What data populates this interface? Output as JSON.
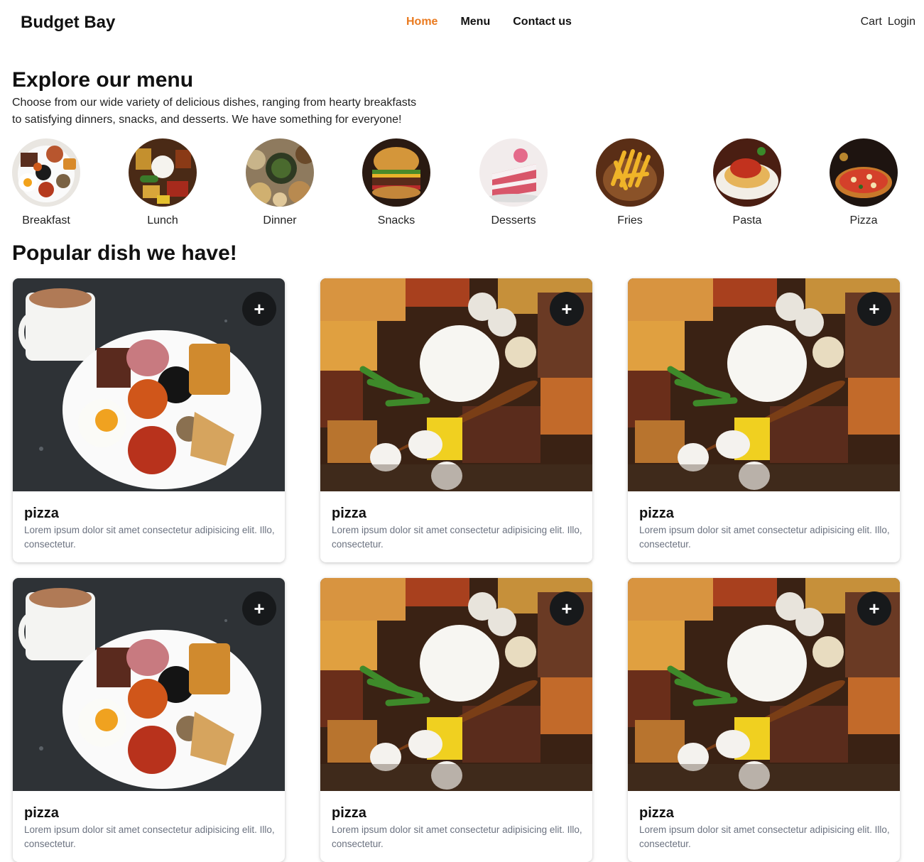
{
  "header": {
    "brand": "Budget Bay",
    "nav": [
      {
        "label": "Home",
        "active": true
      },
      {
        "label": "Menu",
        "active": false
      },
      {
        "label": "Contact us",
        "active": false
      }
    ],
    "cart_label": "Cart",
    "login_label": "Login"
  },
  "explore": {
    "title": "Explore our menu",
    "description": "Choose from our wide variety of delicious dishes, ranging from hearty breakfasts to satisfying dinners, snacks, and desserts. We have something for everyone!",
    "categories": [
      {
        "label": "Breakfast"
      },
      {
        "label": "Lunch"
      },
      {
        "label": "Dinner"
      },
      {
        "label": "Snacks"
      },
      {
        "label": "Desserts"
      },
      {
        "label": "Fries"
      },
      {
        "label": "Pasta"
      },
      {
        "label": "Pizza"
      }
    ]
  },
  "popular": {
    "title": "Popular dish we have!",
    "add_icon": "+",
    "dishes": [
      {
        "name": "pizza",
        "description": "Lorem ipsum dolor sit amet consectetur adipisicing elit. Illo, consectetur.",
        "image": "breakfast-plate"
      },
      {
        "name": "pizza",
        "description": "Lorem ipsum dolor sit amet consectetur adipisicing elit. Illo, consectetur.",
        "image": "rice-platter"
      },
      {
        "name": "pizza",
        "description": "Lorem ipsum dolor sit amet consectetur adipisicing elit. Illo, consectetur.",
        "image": "rice-platter"
      },
      {
        "name": "pizza",
        "description": "Lorem ipsum dolor sit amet consectetur adipisicing elit. Illo, consectetur.",
        "image": "breakfast-plate"
      },
      {
        "name": "pizza",
        "description": "Lorem ipsum dolor sit amet consectetur adipisicing elit. Illo, consectetur.",
        "image": "rice-platter"
      },
      {
        "name": "pizza",
        "description": "Lorem ipsum dolor sit amet consectetur adipisicing elit. Illo, consectetur.",
        "image": "rice-platter"
      }
    ]
  },
  "colors": {
    "accent": "#ea7a1f",
    "add_button": "#17191b",
    "muted_text": "#6b7280"
  }
}
